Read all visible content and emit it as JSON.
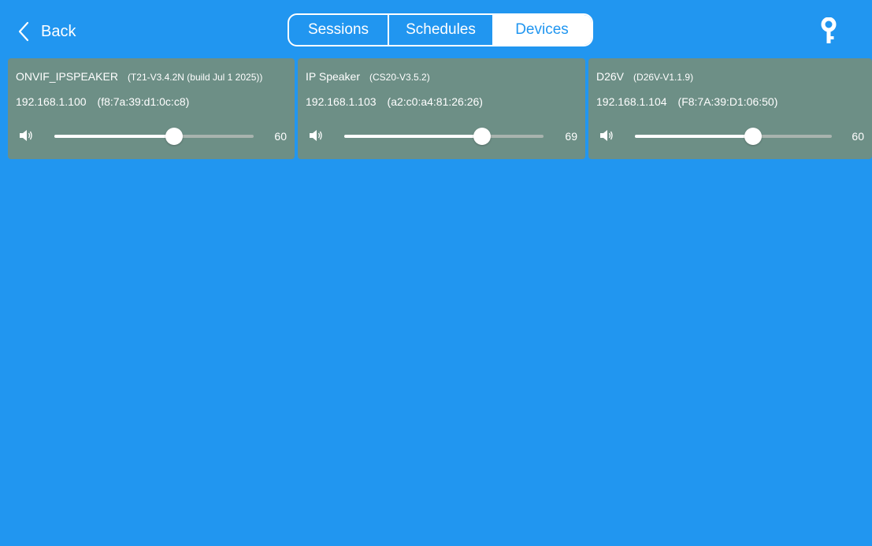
{
  "topbar": {
    "back_label": "Back",
    "tabs": [
      {
        "label": "Sessions",
        "selected": false
      },
      {
        "label": "Schedules",
        "selected": false
      },
      {
        "label": "Devices",
        "selected": true
      }
    ],
    "key_icon": "key-icon"
  },
  "devices": [
    {
      "name": "ONVIF_IPSPEAKER",
      "firmware": "(T21-V3.4.2N (build Jul  1 2025))",
      "ip": "192.168.1.100",
      "mac": "(f8:7a:39:d1:0c:c8)",
      "volume": "60",
      "volume_fraction": 0.6
    },
    {
      "name": "IP Speaker",
      "firmware": "(CS20-V3.5.2)",
      "ip": "192.168.1.103",
      "mac": "(a2:c0:a4:81:26:26)",
      "volume": "69",
      "volume_fraction": 0.69
    },
    {
      "name": "D26V",
      "firmware": "(D26V-V1.1.9)",
      "ip": "192.168.1.104",
      "mac": "(F8:7A:39:D1:06:50)",
      "volume": "60",
      "volume_fraction": 0.6
    }
  ],
  "colors": {
    "background": "#2196f0",
    "card": "#6d8f86",
    "selected_tab_text": "#2196f0"
  }
}
